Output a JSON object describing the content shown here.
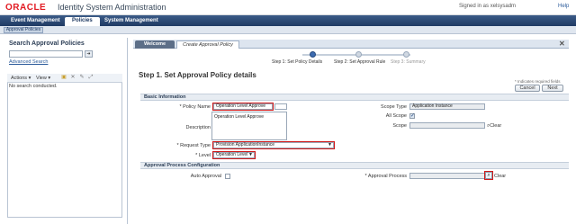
{
  "header": {
    "logo": "ORACLE",
    "title": "Identity System Administration",
    "signed_in": "Signed in as xelsysadm",
    "help": "Help"
  },
  "nav": {
    "tabs": [
      "Event Management",
      "Policies",
      "System Management"
    ],
    "active": "Policies",
    "sub_button": "Approval Policies"
  },
  "left_panel": {
    "title": "Search Approval Policies",
    "search_value": "",
    "go_icon": "arrow-right-icon",
    "advanced_search": "Advanced Search",
    "toolbar": {
      "actions": "Actions",
      "view": "View"
    },
    "empty_message": "No search conducted."
  },
  "main": {
    "tabs": [
      "Welcome",
      "Create Approval Policy"
    ],
    "train": {
      "steps": [
        "Step 1: Set Policy Details",
        "Step 2: Set Approval Rule",
        "Step 3: Summary"
      ],
      "current": 0
    },
    "step_title": "Step 1. Set Approval Policy details",
    "required_note": "* Indicates required fields",
    "buttons": {
      "cancel": "Cancel",
      "next": "Next"
    },
    "basic_info": {
      "header": "Basic Information",
      "policy_name_label": "* Policy Name",
      "policy_name_value": "Operation Level Approve",
      "description_label": "Description",
      "description_value": "Operation Level Approve",
      "request_type_label": "* Request Type",
      "request_type_value": "Provision ApplicationInstance",
      "level_label": "* Level",
      "level_value": "Operation Level",
      "scope_type_label": "Scope Type",
      "scope_type_value": "Application Instance",
      "all_scope_label": "All Scope",
      "all_scope_checked": true,
      "scope_label": "Scope",
      "scope_value": "",
      "clear": "Clear"
    },
    "approval_config": {
      "header": "Approval Process Configuration",
      "auto_approval_label": "Auto Approval",
      "auto_approval_checked": false,
      "approval_process_label": "* Approval Process",
      "approval_process_value": "",
      "clear": "Clear"
    }
  }
}
